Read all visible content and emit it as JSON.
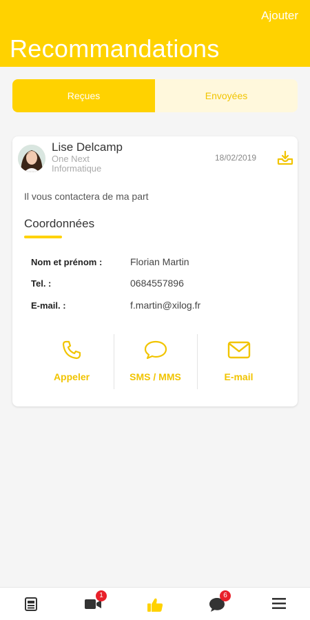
{
  "header": {
    "title": "Recommandations",
    "add_label": "Ajouter"
  },
  "tabs": [
    {
      "label": "Reçues",
      "active": true
    },
    {
      "label": "Envoyées",
      "active": false
    }
  ],
  "recommendation": {
    "sender_name": "Lise Delcamp",
    "company": "One Next Informatique",
    "date": "18/02/2019",
    "message": "Il vous contactera de ma part",
    "section_title": "Coordonnées",
    "fields": [
      {
        "label": "Nom et prénom :",
        "value": "Florian Martin"
      },
      {
        "label": "Tel. :",
        "value": "0684557896"
      },
      {
        "label": "E-mail. :",
        "value": "f.martin@xilog.fr"
      }
    ],
    "actions": [
      {
        "label": "Appeler",
        "icon": "phone-icon"
      },
      {
        "label": "SMS / MMS",
        "icon": "chat-bubble-icon"
      },
      {
        "label": "E-mail",
        "icon": "envelope-icon"
      }
    ]
  },
  "bottom_nav": {
    "items": [
      {
        "icon": "news-icon",
        "badge": ""
      },
      {
        "icon": "video-icon",
        "badge": "1"
      },
      {
        "icon": "thumbs-up-icon",
        "badge": "",
        "active": true
      },
      {
        "icon": "chat-icon",
        "badge": "6"
      },
      {
        "icon": "menu-icon",
        "badge": ""
      }
    ]
  },
  "colors": {
    "accent": "#ffd200",
    "accent_text": "#f1c400",
    "inactive_tab_bg": "#fff8dc",
    "badge": "#e8202a",
    "background": "#f5f5f5"
  }
}
